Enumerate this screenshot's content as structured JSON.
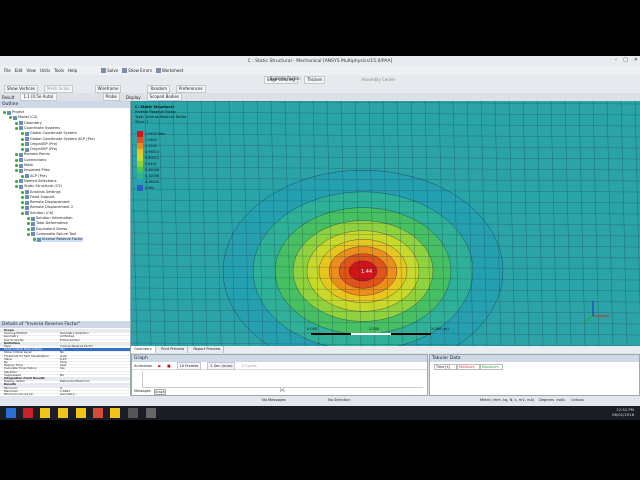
{
  "window": {
    "title": "C : Static Structural - Mechanical [ANSYS Multiphysics/15.0/PAA]"
  },
  "menu": [
    "File",
    "Edit",
    "View",
    "Units",
    "Tools",
    "Help"
  ],
  "toolbar1": {
    "solve": "Solve",
    "show_errors": "Show Errors",
    "worksheet": "Worksheet",
    "edge_coloring": "Edge Coloring",
    "thicken": "Thicken",
    "assembly_center": "Assembly Center"
  },
  "toolbar2": {
    "show_vertices": "Show Vertices",
    "mesh_scale": "Mesh Scale",
    "wireframe": "Wireframe",
    "random": "Random",
    "preferences": "Preferences",
    "explode_factor": "Explode Factor:"
  },
  "toolbar3": {
    "result_label": "Result",
    "result_value": "1.1 (0.5e Auto)",
    "probe": "Probe",
    "display_label": "Display",
    "display_value": "Scoped Bodies"
  },
  "outline": {
    "title": "Outline",
    "items": [
      {
        "label": "Project",
        "indent": 0
      },
      {
        "label": "Model (C4)",
        "indent": 1
      },
      {
        "label": "Geometry",
        "indent": 2
      },
      {
        "label": "Coordinate Systems",
        "indent": 2
      },
      {
        "label": "Global Coordinate System",
        "indent": 3
      },
      {
        "label": "Global Coordinate System ACP (Pre)",
        "indent": 3
      },
      {
        "label": "OriginSKP (Pre)",
        "indent": 3
      },
      {
        "label": "OriginSKP (Pre)",
        "indent": 3
      },
      {
        "label": "Remote Points",
        "indent": 2
      },
      {
        "label": "Connections",
        "indent": 2
      },
      {
        "label": "Mesh",
        "indent": 2
      },
      {
        "label": "Imported Plies",
        "indent": 2
      },
      {
        "label": "ACP (Pre)",
        "indent": 3
      },
      {
        "label": "Named Selections",
        "indent": 2
      },
      {
        "label": "Static Structural (C5)",
        "indent": 2
      },
      {
        "label": "Analysis Settings",
        "indent": 3
      },
      {
        "label": "Fixed Support",
        "indent": 3
      },
      {
        "label": "Remote Displacement",
        "indent": 3
      },
      {
        "label": "Remote Displacement 2",
        "indent": 3
      },
      {
        "label": "Solution (C6)",
        "indent": 3
      },
      {
        "label": "Solution Information",
        "indent": 4
      },
      {
        "label": "Total Deformation",
        "indent": 4
      },
      {
        "label": "Equivalent Stress",
        "indent": 4
      },
      {
        "label": "Composite Failure Tool",
        "indent": 4
      },
      {
        "label": "Inverse Reserve Factor",
        "indent": 5
      }
    ]
  },
  "details": {
    "title": "Details of \"Inverse Reserve Factor\"",
    "rows": [
      {
        "k": "Scope",
        "v": "",
        "sec": true
      },
      {
        "k": "Scoping Method",
        "v": "Geometry Selection"
      },
      {
        "k": "Geometry",
        "v": "All Bodies"
      },
      {
        "k": "Sub Scope By",
        "v": "Entire Section"
      },
      {
        "k": "Definition",
        "v": "",
        "sec": true
      },
      {
        "k": "Type",
        "v": "Inverse Reserve Factor"
      },
      {
        "k": "Show Critical Failure Mode",
        "v": "Yes",
        "sel": true
      },
      {
        "k": "Show Critical Layer",
        "v": "No"
      },
      {
        "k": "Threshold for Text Visualization",
        "v": "Auto"
      },
      {
        "k": "Value",
        "v": "0.25"
      },
      {
        "k": "By",
        "v": "Time"
      },
      {
        "k": "Display Time",
        "v": "Last"
      },
      {
        "k": "Calculate Time History",
        "v": "Yes"
      },
      {
        "k": "Identifier",
        "v": ""
      },
      {
        "k": "Suppressed",
        "v": "No"
      },
      {
        "k": "Integration Point Results",
        "v": "",
        "sec": true
      },
      {
        "k": "Display Option",
        "v": "Elemental Maximum"
      },
      {
        "k": "Results",
        "v": "",
        "sec": true
      },
      {
        "k": "Minimum",
        "v": "0."
      },
      {
        "k": "Maximum",
        "v": "1.4402"
      },
      {
        "k": "Minimum Occurs On",
        "v": "Geometry..."
      }
    ]
  },
  "viewport": {
    "result_title": "C: Static Structural",
    "result_sub1": "Inverse Reserve Factor",
    "result_sub2": "Type: Inverse Reserve Factor",
    "result_sub3": "Time: 1",
    "legend": [
      "1.4402 Max",
      "1.2802",
      "1.1202",
      "0.96013",
      "0.80011",
      "0.6401",
      "0.48008",
      "0.32006",
      "0.16004",
      "0 Min"
    ],
    "legend_colors": [
      "#d0141a",
      "#e0521a",
      "#ec8a1c",
      "#e8c320",
      "#c9d82a",
      "#8ed23a",
      "#4fc456",
      "#2eb592",
      "#2a9fb9",
      "#2a5dc8"
    ],
    "peak_label": "1.44",
    "scale_labels": [
      "0.000",
      "2.500",
      "5.000 (m)"
    ]
  },
  "bottom_tabs": [
    "Geometry",
    "Print Preview",
    "Report Preview"
  ],
  "graph": {
    "title": "Graph",
    "animation_label": "Animation",
    "frames": "10 Frames",
    "duration": "2 Sec (Auto)",
    "cycles": "3 Cycles",
    "x_axis_label": "[s]",
    "tabs": [
      "Messages",
      "Graph"
    ]
  },
  "tabular": {
    "title": "Tabular Data",
    "headers": [
      "Time [s]",
      "Minimum",
      "Maximum"
    ]
  },
  "status": {
    "messages": "No Messages",
    "selection": "No Selection",
    "units": "Metric (mm, kg, N, s, mV, mA)",
    "degrees": "Degrees",
    "rad": "rad/s",
    "temp": "Celsius"
  },
  "taskbar": {
    "time": "12:52 PM",
    "date": "06/01/2018"
  }
}
